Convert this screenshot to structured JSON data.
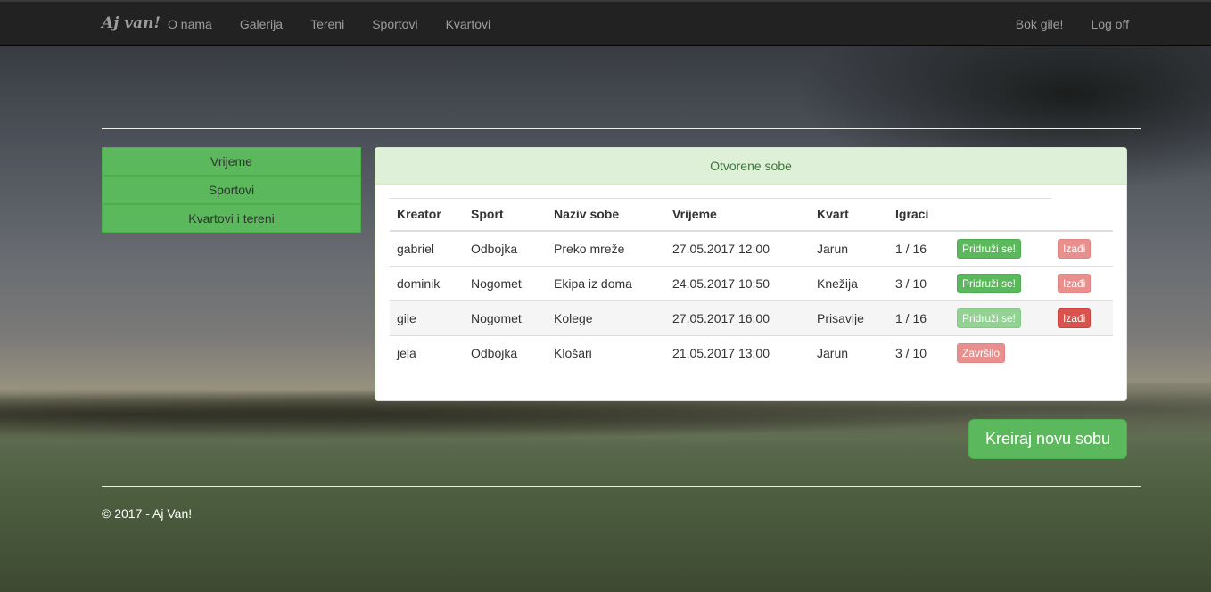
{
  "navbar": {
    "brand": "Aj van!",
    "links": [
      "O nama",
      "Galerija",
      "Tereni",
      "Sportovi",
      "Kvartovi"
    ],
    "greeting": "Bok gile!",
    "logoff": "Log off"
  },
  "filters": [
    "Vrijeme",
    "Sportovi",
    "Kvartovi i tereni"
  ],
  "panel": {
    "title": "Otvorene sobe",
    "columns": [
      "Kreator",
      "Sport",
      "Naziv sobe",
      "Vrijeme",
      "Kvart",
      "Igraci"
    ],
    "rows": [
      {
        "creator": "gabriel",
        "sport": "Odbojka",
        "name": "Preko mreže",
        "time": "27.05.2017 12:00",
        "district": "Jarun",
        "players": "1 / 16",
        "join": "Pridruži se!",
        "leave": "Izađi"
      },
      {
        "creator": "dominik",
        "sport": "Nogomet",
        "name": "Ekipa iz doma",
        "time": "24.05.2017 10:50",
        "district": "Knežija",
        "players": "3 / 10",
        "join": "Pridruži se!",
        "leave": "Izađi"
      },
      {
        "creator": "gile",
        "sport": "Nogomet",
        "name": "Kolege",
        "time": "27.05.2017 16:00",
        "district": "Prisavlje",
        "players": "1 / 16",
        "join": "Pridruži se!",
        "leave": "Izađi"
      },
      {
        "creator": "jela",
        "sport": "Odbojka",
        "name": "Klošari",
        "time": "21.05.2017 13:00",
        "district": "Jarun",
        "players": "3 / 10",
        "status": "Završilo"
      }
    ]
  },
  "create_button": "Kreiraj novu sobu",
  "footer": "© 2017 - Aj Van!"
}
